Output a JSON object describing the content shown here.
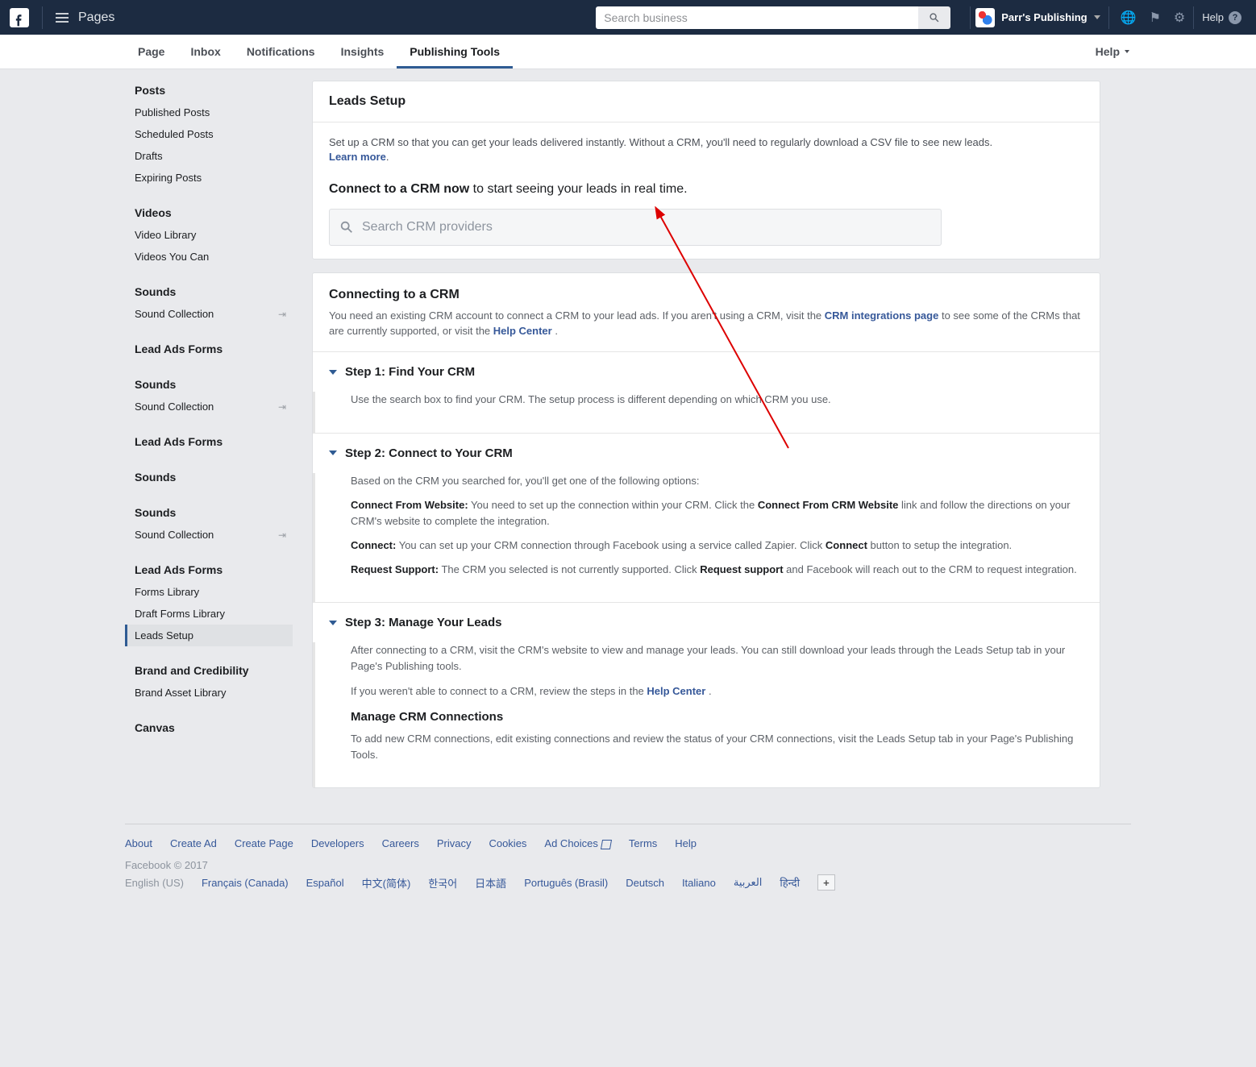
{
  "topbar": {
    "pages_label": "Pages",
    "search_placeholder": "Search business",
    "page_name": "Parr's Publishing",
    "help_label": "Help"
  },
  "tabs": {
    "items": [
      "Page",
      "Inbox",
      "Notifications",
      "Insights",
      "Publishing Tools"
    ],
    "active_index": 4,
    "help_label": "Help"
  },
  "sidebar": [
    {
      "head": "Posts",
      "items": [
        {
          "label": "Published Posts"
        },
        {
          "label": "Scheduled Posts"
        },
        {
          "label": "Drafts"
        },
        {
          "label": "Expiring Posts"
        }
      ]
    },
    {
      "head": "Videos",
      "items": [
        {
          "label": "Video Library"
        },
        {
          "label": "Videos You Can"
        }
      ]
    },
    {
      "head": "Sounds",
      "items": [
        {
          "label": "Sound Collection",
          "ext": true
        }
      ]
    },
    {
      "head": "Lead Ads Forms",
      "items": []
    },
    {
      "head": "Sounds",
      "items": [
        {
          "label": "Sound Collection",
          "ext": true
        }
      ]
    },
    {
      "head": "Lead Ads Forms",
      "items": []
    },
    {
      "head": "Sounds",
      "items": []
    },
    {
      "head": "Sounds",
      "items": [
        {
          "label": "Sound Collection",
          "ext": true
        }
      ]
    },
    {
      "head": "Lead Ads Forms",
      "items": [
        {
          "label": "Forms Library"
        },
        {
          "label": "Draft Forms Library"
        },
        {
          "label": "Leads Setup",
          "active": true
        }
      ]
    },
    {
      "head": "Brand and Credibility",
      "items": [
        {
          "label": "Brand Asset Library"
        }
      ]
    },
    {
      "head": "Canvas",
      "items": []
    }
  ],
  "leads_setup": {
    "title": "Leads Setup",
    "intro": "Set up a CRM so that you can get your leads delivered instantly. Without a CRM, you'll need to regularly download a CSV file to see new leads.",
    "learn_more": "Learn more",
    "connect_head_bold": "Connect to a CRM now",
    "connect_head_rest": " to start seeing your leads in real time.",
    "crm_search_placeholder": "Search CRM providers"
  },
  "connecting": {
    "title": "Connecting to a CRM",
    "desc_pre": "You need an existing CRM account to connect a CRM to your lead ads. If you aren't using a CRM, visit the ",
    "crm_link": "CRM integrations page",
    "desc_mid": " to see some of the CRMs that are currently supported, or visit the ",
    "help_link": "Help Center",
    "desc_end": " ."
  },
  "steps": [
    {
      "title": "Step 1: Find Your CRM",
      "body": "Use the search box to find your CRM. The setup process is different depending on which CRM you use."
    },
    {
      "title": "Step 2: Connect to Your CRM",
      "intro": "Based on the CRM you searched for, you'll get one of the following options:",
      "opts": [
        {
          "label": "Connect From Website:",
          "text": " You need to set up the connection within your CRM. Click the ",
          "strong": "Connect From CRM Website",
          "text2": " link and follow the directions on your CRM's website to complete the integration."
        },
        {
          "label": "Connect:",
          "text": " You can set up your CRM connection through Facebook using a service called Zapier. Click ",
          "strong": "Connect",
          "text2": " button to setup the integration."
        },
        {
          "label": "Request Support:",
          "text": " The CRM you selected is not currently supported. Click ",
          "strong": "Request support",
          "text2": " and Facebook will reach out to the CRM to request integration."
        }
      ]
    },
    {
      "title": "Step 3: Manage Your Leads",
      "p1": "After connecting to a CRM, visit the CRM's website to view and manage your leads. You can still download your leads through the Leads Setup tab in your Page's Publishing tools.",
      "p2_pre": "If you weren't able to connect to a CRM, review the steps in the ",
      "p2_link": "Help Center",
      "p2_end": " .",
      "sub_title": "Manage CRM Connections",
      "sub_body": "To add new CRM connections, edit existing connections and review the status of your CRM connections, visit the Leads Setup tab in your Page's Publishing Tools."
    }
  ],
  "footer": {
    "row1": [
      "About",
      "Create Ad",
      "Create Page",
      "Developers",
      "Careers",
      "Privacy",
      "Cookies",
      "Ad Choices",
      "Terms",
      "Help"
    ],
    "copyright": "Facebook © 2017",
    "langs_current": "English (US)",
    "langs": [
      "Français (Canada)",
      "Español",
      "中文(简体)",
      "한국어",
      "日本語",
      "Português (Brasil)",
      "Deutsch",
      "Italiano",
      "العربية",
      "हिन्दी"
    ]
  }
}
